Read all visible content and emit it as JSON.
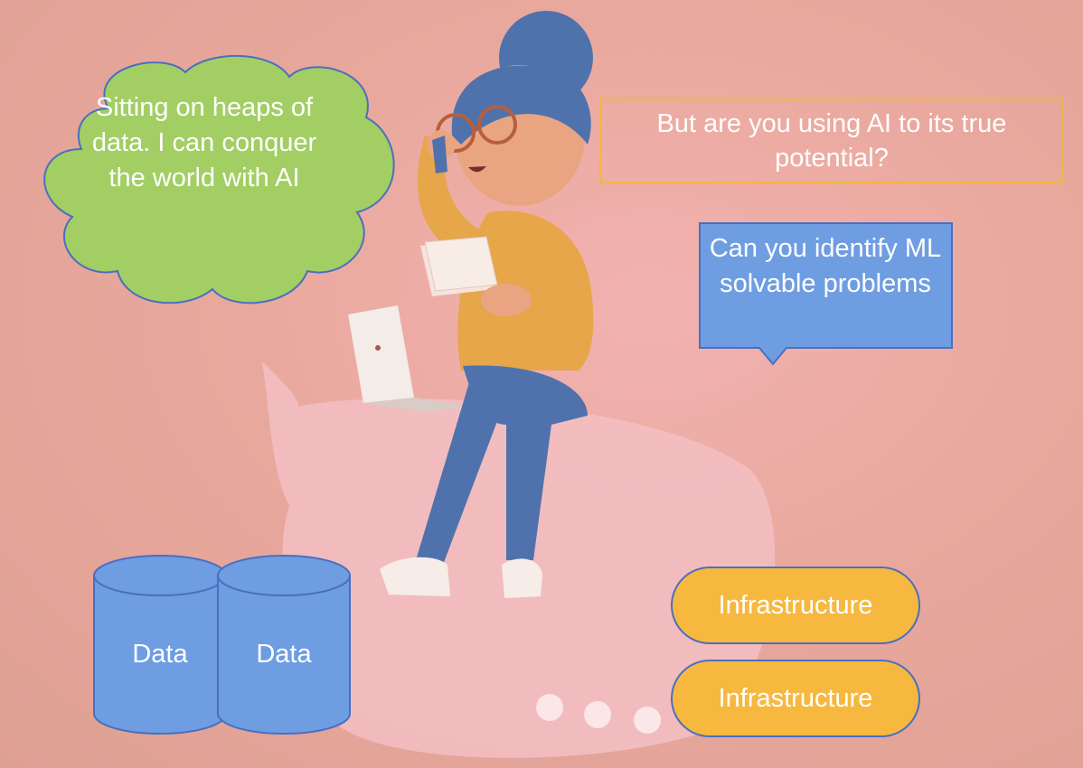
{
  "thought_bubble": {
    "text": "Sitting on heaps of data. I can conquer the world with AI"
  },
  "question_box": {
    "text": "But are you using AI to its true potential?"
  },
  "callout": {
    "text": "Can you identify ML solvable problems"
  },
  "databases": [
    {
      "label": "Data"
    },
    {
      "label": "Data"
    }
  ],
  "infrastructure": [
    {
      "label": "Infrastructure"
    },
    {
      "label": "Infrastructure"
    }
  ],
  "colors": {
    "background": "#e9a89d",
    "thought_bubble": "#a2ce63",
    "callout": "#6e9de2",
    "cylinder": "#6e9de2",
    "pill": "#f6b83f",
    "question_border": "#f4b63e"
  }
}
